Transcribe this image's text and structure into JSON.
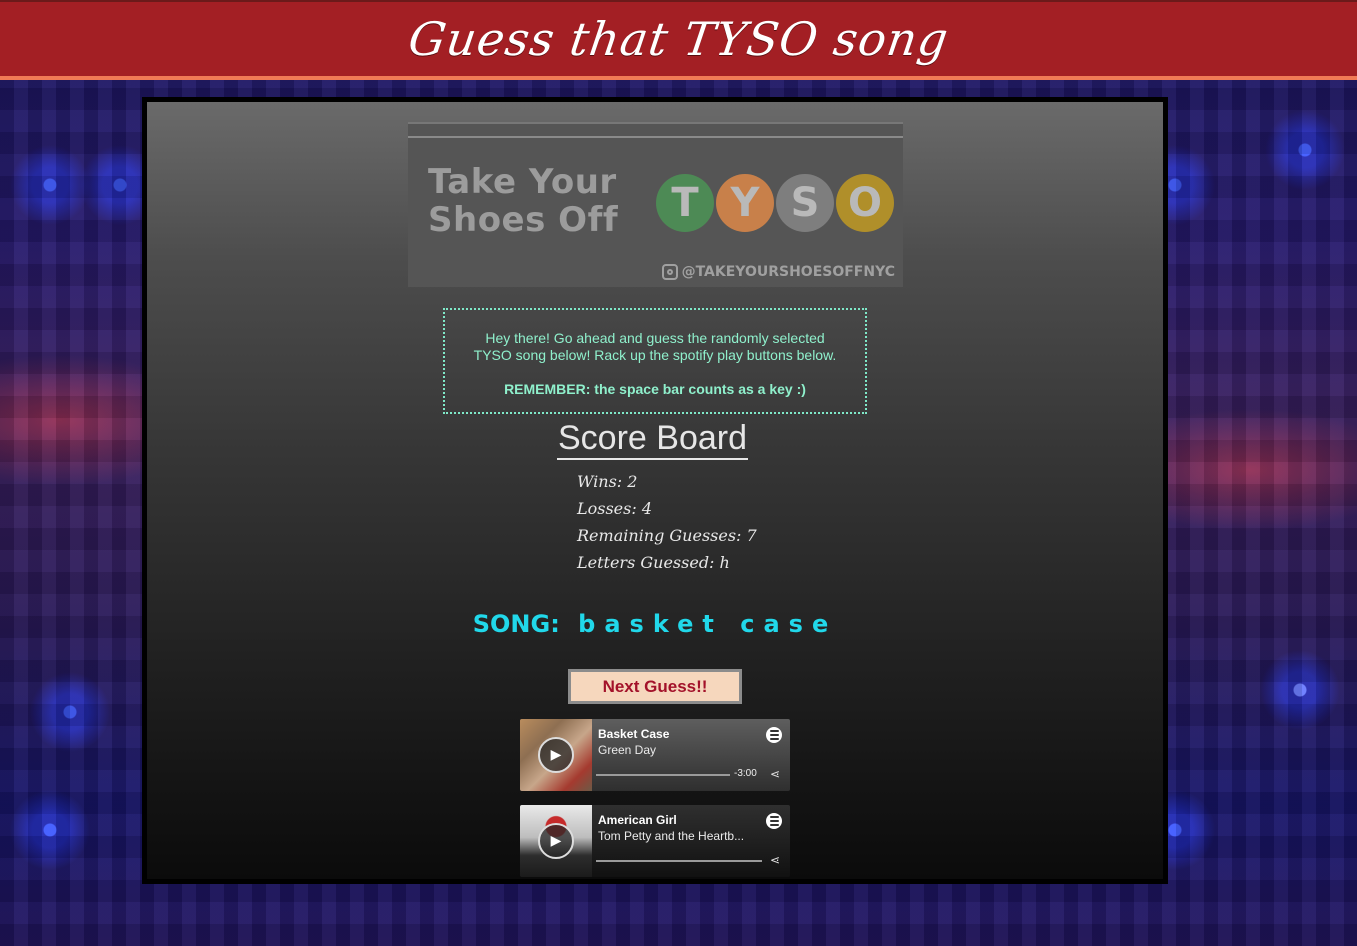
{
  "header": {
    "title": "Guess that TYSO song"
  },
  "logo": {
    "line1": "Take Your",
    "line2": "Shoes Off",
    "letters": [
      {
        "char": "T",
        "color": "#4d8a55"
      },
      {
        "char": "Y",
        "color": "#c8804a"
      },
      {
        "char": "S",
        "color": "#7e7e7e"
      },
      {
        "char": "O",
        "color": "#b08f2a"
      }
    ],
    "handle": "@TAKEYOURSHOESOFFNYC",
    "icon": "instagram-icon"
  },
  "intro": {
    "line1": "Hey there! Go ahead and guess the randomly selected",
    "line2": "TYSO song below! Rack up the spotify play buttons below.",
    "reminder": "REMEMBER: the space bar counts as a key :)"
  },
  "scoreboard": {
    "title": "Score Board",
    "wins": "Wins: 2",
    "losses": "Losses: 4",
    "remaining": "Remaining Guesses: 7",
    "letters": "Letters Guessed: h"
  },
  "song": {
    "label": "SONG:",
    "word": "basket case"
  },
  "next_button": {
    "label": "Next Guess!!"
  },
  "players": [
    {
      "title": "Basket Case",
      "artist": "Green Day",
      "time": "-3:00"
    },
    {
      "title": "American Girl",
      "artist": "Tom Petty and the Heartb...",
      "time": ""
    }
  ],
  "colors": {
    "header_bg": "#a31f24",
    "header_border": "#f07a56",
    "intro_text": "#8ff0cc",
    "song_text": "#21d8ea",
    "button_bg": "#f6d7bd",
    "button_text": "#a3122a"
  }
}
